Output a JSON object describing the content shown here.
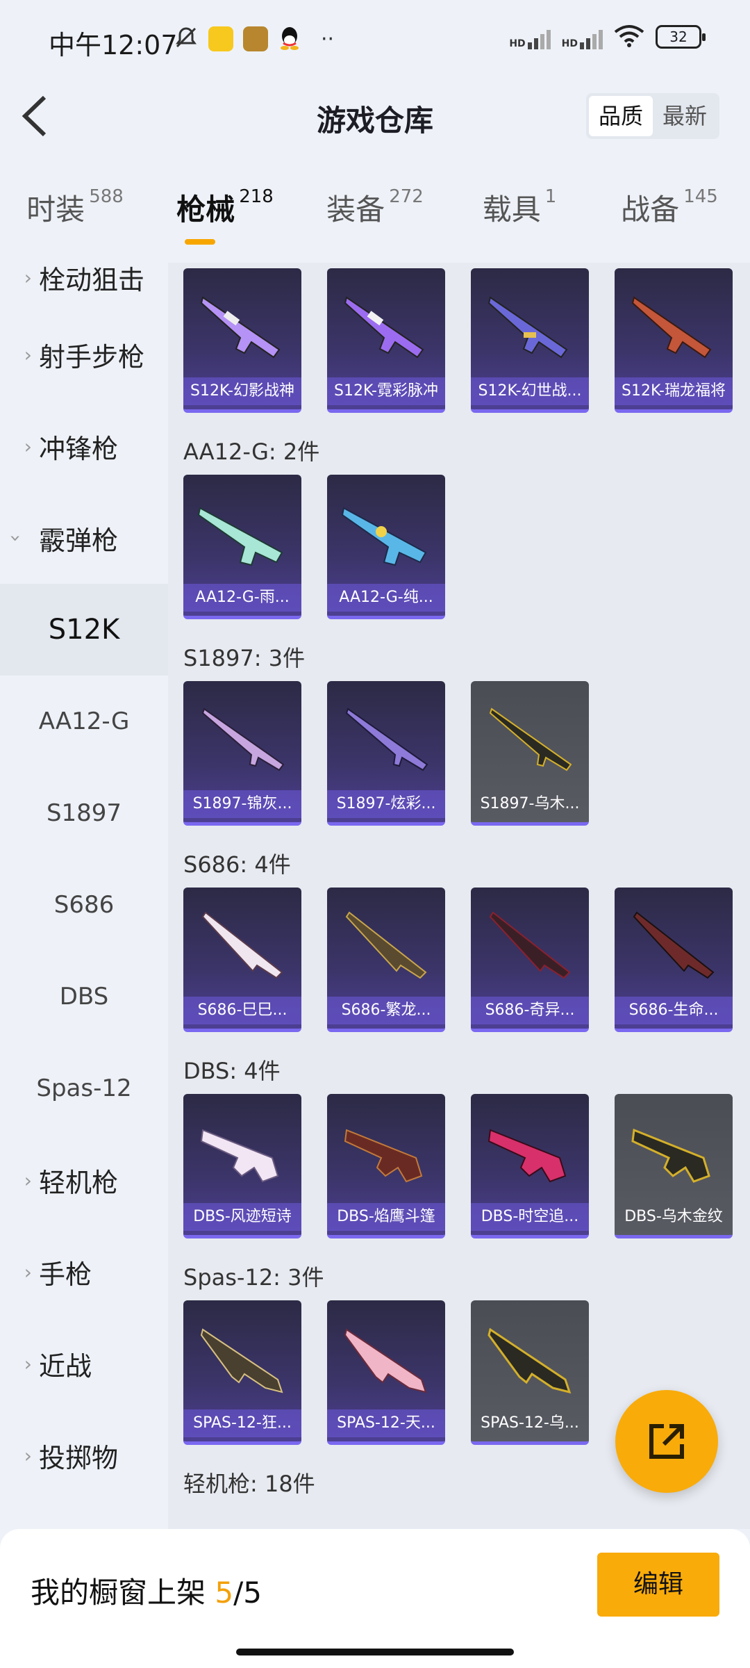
{
  "status_bar": {
    "time": "中午12:07",
    "battery": "32",
    "net1": "HD",
    "net2": "HD"
  },
  "header": {
    "title": "游戏仓库",
    "sort_options": [
      "品质",
      "最新"
    ],
    "sort_active": "品质"
  },
  "tabs": [
    {
      "label": "时装",
      "count": "588"
    },
    {
      "label": "枪械",
      "count": "218"
    },
    {
      "label": "装备",
      "count": "272"
    },
    {
      "label": "载具",
      "count": "1"
    },
    {
      "label": "战备",
      "count": "145"
    }
  ],
  "sidebar": {
    "cat_sniper": "栓动狙击",
    "cat_marksman": "射手步枪",
    "cat_smg": "冲锋枪",
    "cat_shotgun": "霰弹枪",
    "sub": [
      "S12K",
      "AA12-G",
      "S1897",
      "S686",
      "DBS",
      "Spas-12"
    ],
    "cat_lmg": "轻机枪",
    "cat_pistol": "手枪",
    "cat_melee": "近战",
    "cat_throw": "投掷物"
  },
  "groups": {
    "s12k": {
      "items": [
        "S12K-幻影战神",
        "S12K-霓彩脉冲",
        "S12K-幻世战...",
        "S12K-瑞龙福将"
      ]
    },
    "aa12": {
      "title": "AA12-G: 2件",
      "items": [
        "AA12-G-雨...",
        "AA12-G-纯..."
      ]
    },
    "s1897": {
      "title": "S1897: 3件",
      "items": [
        "S1897-锦灰...",
        "S1897-炫彩...",
        "S1897-乌木..."
      ]
    },
    "s686": {
      "title": "S686: 4件",
      "items": [
        "S686-巳巳...",
        "S686-繁龙...",
        "S686-奇异...",
        "S686-生命..."
      ]
    },
    "dbs": {
      "title": "DBS: 4件",
      "items": [
        "DBS-风迹短诗",
        "DBS-焰鹰斗篷",
        "DBS-时空追...",
        "DBS-乌木金纹"
      ]
    },
    "spas": {
      "title": "Spas-12: 3件",
      "items": [
        "SPAS-12-狂...",
        "SPAS-12-天...",
        "SPAS-12-乌..."
      ]
    },
    "lmg": {
      "title": "轻机枪: 18件"
    }
  },
  "bottom": {
    "label": "我的橱窗上架",
    "current": "5",
    "slash_total": "/5",
    "edit": "编辑"
  },
  "colors": {
    "accent": "#f9ab0a",
    "card_purple": "#4d3f93",
    "card_grey": "#595b63"
  }
}
